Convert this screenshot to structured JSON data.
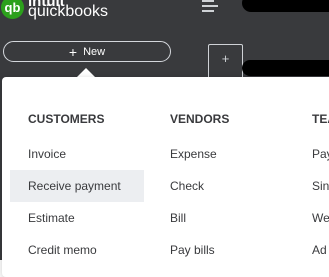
{
  "brand": {
    "logo_letter": "qb",
    "name_top": "intuit",
    "name_bottom": "quickbooks"
  },
  "new_button": {
    "icon": "plus-icon",
    "label": "New"
  },
  "header": {
    "add_tile_icon": "plus-icon"
  },
  "new_menu": {
    "columns": [
      {
        "header": "CUSTOMERS",
        "items": [
          "Invoice",
          "Receive payment",
          "Estimate",
          "Credit memo"
        ],
        "highlighted_index": 1
      },
      {
        "header": "VENDORS",
        "items": [
          "Expense",
          "Check",
          "Bill",
          "Pay bills"
        ]
      },
      {
        "header": "TEA",
        "items": [
          "Pay",
          "Sin",
          "We",
          "Ad"
        ]
      }
    ]
  },
  "colors": {
    "sidebar_bg": "#393a3d",
    "brand_green": "#2ca01c",
    "hover_bg": "#eceef1",
    "text": "#393a3d"
  }
}
